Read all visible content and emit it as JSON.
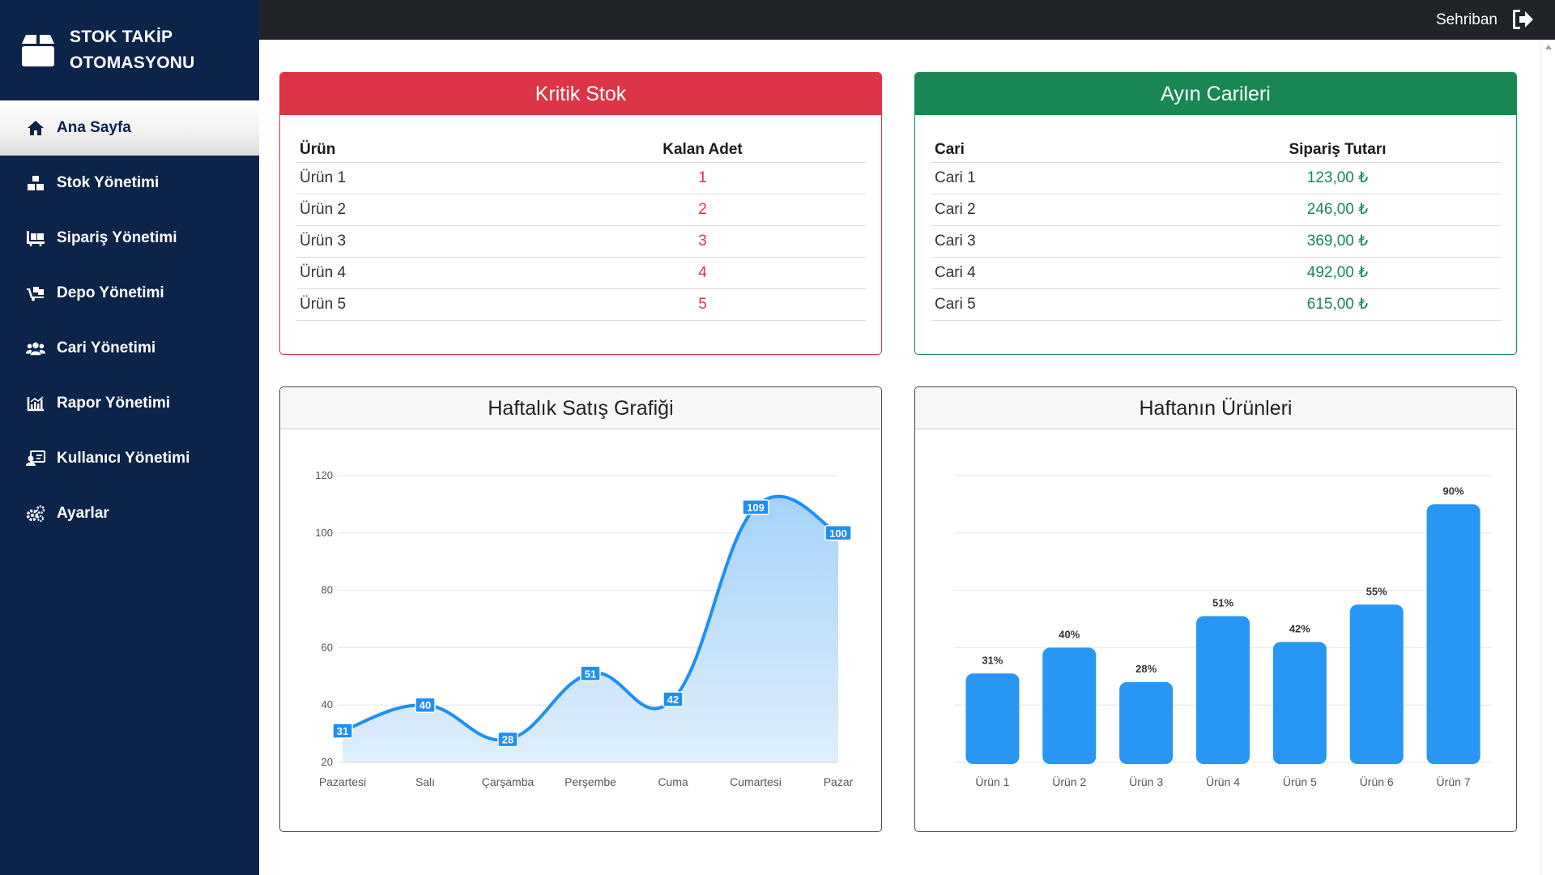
{
  "app": {
    "title_line1": "STOK TAKİP",
    "title_line2": "OTOMASYONU",
    "brand_icon": "box-icon"
  },
  "sidebar": {
    "items": [
      {
        "label": "Ana Sayfa",
        "icon": "home-icon",
        "active": true
      },
      {
        "label": "Stok Yönetimi",
        "icon": "boxes-icon"
      },
      {
        "label": "Sipariş Yönetimi",
        "icon": "pallet-icon"
      },
      {
        "label": "Depo Yönetimi",
        "icon": "dolly-icon"
      },
      {
        "label": "Cari Yönetimi",
        "icon": "users-icon"
      },
      {
        "label": "Rapor Yönetimi",
        "icon": "chart-icon"
      },
      {
        "label": "Kullanıcı Yönetimi",
        "icon": "user-card-icon"
      },
      {
        "label": "Ayarlar",
        "icon": "gears-icon"
      }
    ]
  },
  "topbar": {
    "user": "Sehriban",
    "logout_icon": "sign-out-icon"
  },
  "colors": {
    "sidebar_bg": "#0c234a",
    "topbar_bg": "#202428",
    "danger": "#dc3545",
    "success": "#198754",
    "chart_blue": "#1e8ff5"
  },
  "critical_stock": {
    "title": "Kritik Stok",
    "columns": [
      "Ürün",
      "Kalan Adet"
    ],
    "rows": [
      [
        "Ürün 1",
        "1"
      ],
      [
        "Ürün 2",
        "2"
      ],
      [
        "Ürün 3",
        "3"
      ],
      [
        "Ürün 4",
        "4"
      ],
      [
        "Ürün 5",
        "5"
      ]
    ]
  },
  "monthly_accounts": {
    "title": "Ayın Carileri",
    "columns": [
      "Cari",
      "Sipariş Tutarı"
    ],
    "rows": [
      [
        "Cari 1",
        "123,00 ₺"
      ],
      [
        "Cari 2",
        "246,00 ₺"
      ],
      [
        "Cari 3",
        "369,00 ₺"
      ],
      [
        "Cari 4",
        "492,00 ₺"
      ],
      [
        "Cari 5",
        "615,00 ₺"
      ]
    ]
  },
  "chart_data": [
    {
      "type": "area",
      "title": "Haftalık Satış Grafiği",
      "categories": [
        "Pazartesi",
        "Salı",
        "Çarşamba",
        "Perşembe",
        "Cuma",
        "Cumartesi",
        "Pazar"
      ],
      "values": [
        31,
        40,
        28,
        51,
        42,
        109,
        100
      ],
      "ylim": [
        20,
        120
      ],
      "yticks": [
        20,
        40,
        60,
        80,
        100,
        120
      ],
      "grid": true
    },
    {
      "type": "bar",
      "title": "Haftanın Ürünleri",
      "categories": [
        "Ürün 1",
        "Ürün 2",
        "Ürün 3",
        "Ürün 4",
        "Ürün 5",
        "Ürün 6",
        "Ürün 7"
      ],
      "values": [
        31,
        40,
        28,
        51,
        42,
        55,
        90
      ],
      "value_labels": [
        "31%",
        "40%",
        "28%",
        "51%",
        "42%",
        "55%",
        "90%"
      ],
      "ylim": [
        0,
        100
      ],
      "grid": true
    }
  ]
}
